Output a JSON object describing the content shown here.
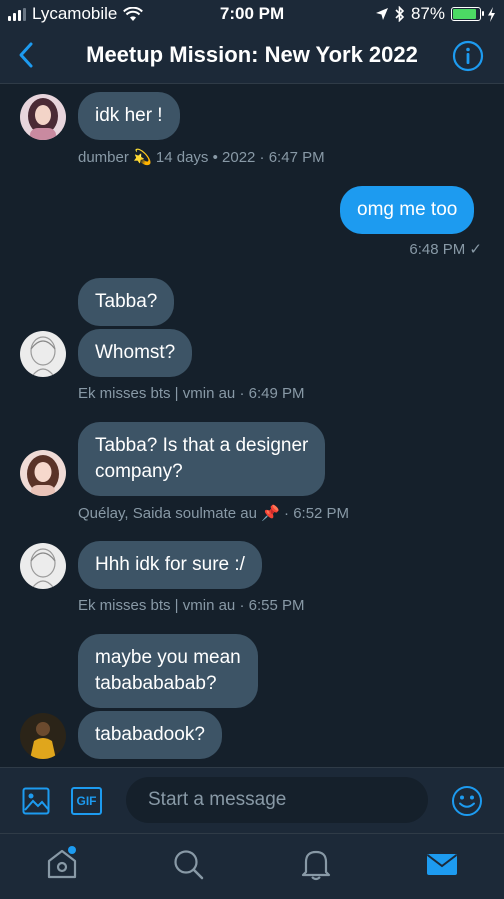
{
  "status": {
    "carrier": "Lycamobile",
    "time": "7:00 PM",
    "battery": "87%",
    "battery_level": 0.87
  },
  "header": {
    "title": "Meetup Mission: New York 2022"
  },
  "messages": [
    {
      "text": "idk her !",
      "meta_name": "dumber",
      "meta_after": "14 days • 2022 · 6:47 PM"
    },
    {
      "text": "omg me too",
      "meta": "6:48 PM ✓"
    },
    {
      "text": "Tabba?"
    },
    {
      "text": "Whomst?",
      "meta": "Ek misses bts | vmin au · 6:49 PM"
    },
    {
      "text_line1": "Tabba? Is that a designer",
      "text_line2": "company?",
      "meta_name": "Quélay, Saida soulmate  au",
      "meta_after": "· 6:52 PM"
    },
    {
      "text": "Hhh idk for sure :/",
      "meta": "Ek misses bts | vmin au · 6:55 PM"
    },
    {
      "text_line1": "maybe you mean",
      "text_line2": "tababababab?"
    },
    {
      "text": "tababadook?"
    }
  ],
  "composer": {
    "placeholder": "Start a message",
    "gif_label": "GIF"
  },
  "icons": {
    "back": "chevron-left-icon",
    "info": "info-icon",
    "image": "image-icon",
    "gif": "gif-icon",
    "emoji": "emoji-icon",
    "home": "home-icon",
    "search": "search-icon",
    "notifications": "bell-icon",
    "messages": "mail-icon"
  },
  "colors": {
    "background": "#15202b",
    "bar": "#1c2938",
    "accent": "#1d9bf0",
    "incoming_bubble": "#3d5466",
    "meta_text": "#8899a6"
  }
}
